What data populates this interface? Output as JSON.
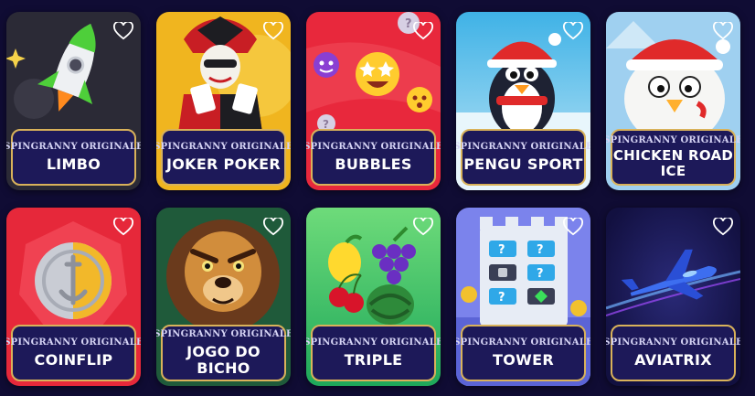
{
  "games": [
    {
      "provider": "SPINGRANNY ORIGINALE",
      "title": "LIMBO",
      "bg": "#2b2a36"
    },
    {
      "provider": "SPINGRANNY ORIGINALE",
      "title": "JOKER POKER",
      "bg": "#f0b51f"
    },
    {
      "provider": "SPINGRANNY ORIGINALE",
      "title": "BUBBLES",
      "bg": "#e8283c"
    },
    {
      "provider": "SPINGRANNY ORIGINALE",
      "title": "PENGU SPORT",
      "bg": "#5fc4ec"
    },
    {
      "provider": "SPINGRANNY ORIGINALE",
      "title": "CHICKEN ROAD ICE",
      "bg": "#9fd0f0"
    },
    {
      "provider": "SPINGRANNY ORIGINALE",
      "title": "COINFLIP",
      "bg": "#e6283a"
    },
    {
      "provider": "SPINGRANNY ORIGINALE",
      "title": "JOGO DO BICHO",
      "bg": "#1f5a3a"
    },
    {
      "provider": "SPINGRANNY ORIGINALE",
      "title": "TRIPLE",
      "bg": "#2ec06a"
    },
    {
      "provider": "SPINGRANNY ORIGINALE",
      "title": "TOWER",
      "bg": "#7b83ec"
    },
    {
      "provider": "SPINGRANNY ORIGINALE",
      "title": "AVIATRIX",
      "bg": "#151445"
    }
  ],
  "colors": {
    "page_bg": "#100c34",
    "label_bg": "#1d1959",
    "label_border": "#d9b25a"
  }
}
